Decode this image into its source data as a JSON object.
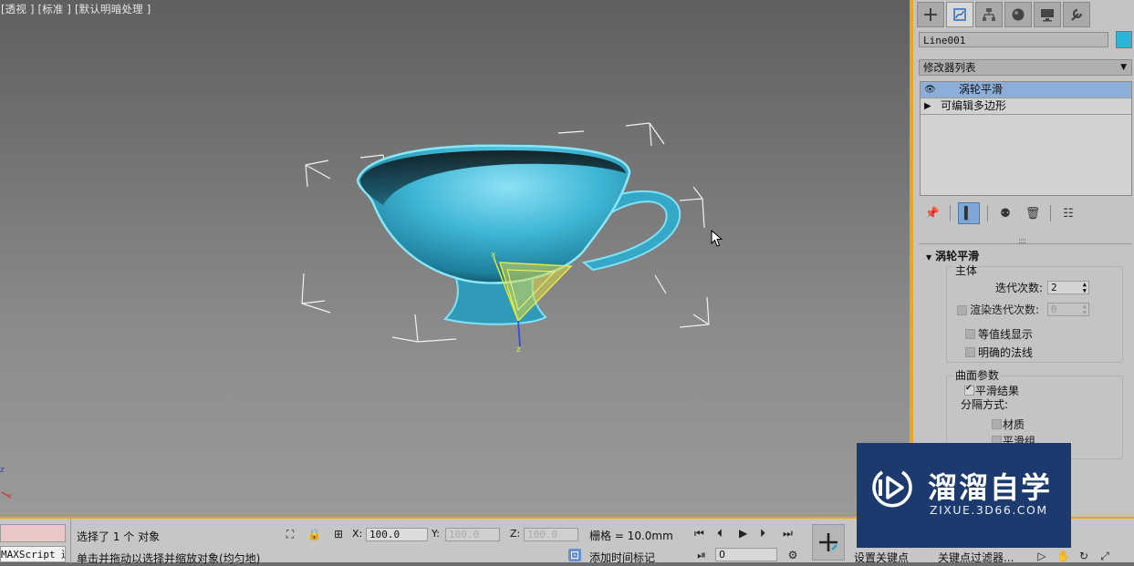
{
  "viewport": {
    "label": "[透视 ] [标准 ] [默认明暗处理 ]",
    "axis_z": "z",
    "axis_x": "x",
    "gizmo_x": "x",
    "gizmo_z": "z"
  },
  "panel": {
    "tabs": [
      "create-icon",
      "modify-icon",
      "hierarchy-icon",
      "motion-icon",
      "display-icon",
      "utilities-icon"
    ],
    "active_tab": "modify-icon",
    "object_name": "Line001",
    "object_color": "#2ab4d8",
    "modifier_list": "修改器列表",
    "stack": [
      {
        "label": "涡轮平滑",
        "selected": true
      },
      {
        "label": "可编辑多边形",
        "selected": false
      }
    ],
    "rollout": {
      "title": "涡轮平滑",
      "main_group": "主体",
      "iterations_label": "迭代次数:",
      "iterations_value": "2",
      "render_iters_label": "渲染迭代次数:",
      "render_iters_value": "0",
      "isoline_label": "等值线显示",
      "explicit_normals_label": "明确的法线",
      "surface_group": "曲面参数",
      "smooth_result_label": "平滑结果",
      "smooth_result_checked": true,
      "separate_by_label": "分隔方式:",
      "materials_label": "材质",
      "smoothing_groups_label": "平滑组"
    }
  },
  "status": {
    "script_label": "MAXScript 迷",
    "selected_text": "选择了 1 个 对象",
    "hint_text": "单击并拖动以选择并缩放对象(均匀地)",
    "x_label": "X:",
    "x_value": "100.0",
    "y_label": "Y:",
    "y_value": "100.0",
    "z_label": "Z:",
    "z_value": "100.0",
    "grid_text": "栅格 = 10.0mm",
    "add_time_tag": "添加时间标记",
    "frame_value": "0",
    "set_key": "设置关键点",
    "key_filters": "关键点过滤器..."
  },
  "watermark": {
    "title": "溜溜自学",
    "subtitle": "ZIXUE.3D66.COM",
    "color": "#1d3a6e"
  }
}
